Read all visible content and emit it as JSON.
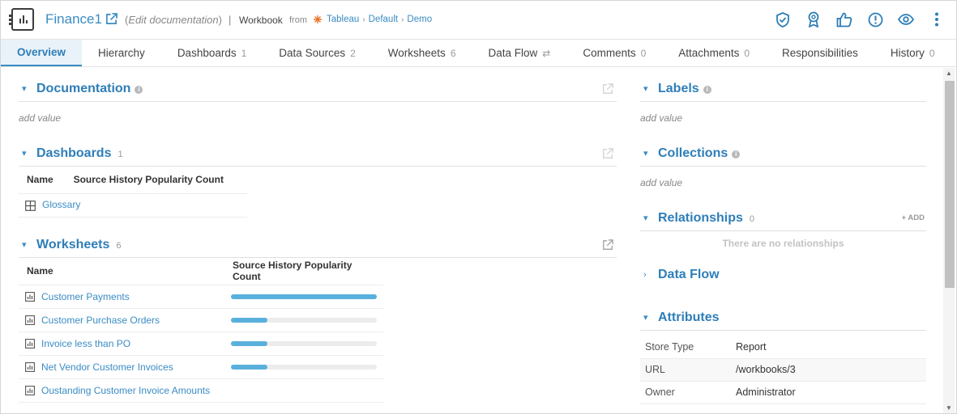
{
  "header": {
    "title": "Finance1",
    "edit_doc_open": "(",
    "edit_doc": "Edit documentation",
    "edit_doc_close": ")",
    "separator": "|",
    "type": "Workbook",
    "from": "from",
    "breadcrumb": [
      "Tableau",
      "Default",
      "Demo"
    ],
    "icons": [
      "shield-check-icon",
      "badge-icon",
      "thumbs-up-icon",
      "alert-icon",
      "eye-icon",
      "more-vertical-icon"
    ]
  },
  "tabs": [
    {
      "label": "Overview",
      "count": ""
    },
    {
      "label": "Hierarchy",
      "count": ""
    },
    {
      "label": "Dashboards",
      "count": "1"
    },
    {
      "label": "Data Sources",
      "count": "2"
    },
    {
      "label": "Worksheets",
      "count": "6"
    },
    {
      "label": "Data Flow",
      "count": "⇄"
    },
    {
      "label": "Comments",
      "count": "0"
    },
    {
      "label": "Attachments",
      "count": "0"
    },
    {
      "label": "Responsibilities",
      "count": ""
    },
    {
      "label": "History",
      "count": "0"
    }
  ],
  "documentation": {
    "title": "Documentation",
    "placeholder": "add value"
  },
  "dashboards": {
    "title": "Dashboards",
    "count": "1",
    "columns": [
      "Name",
      "Source History Popularity Count"
    ],
    "rows": [
      {
        "name": "Glossary"
      }
    ]
  },
  "worksheets": {
    "title": "Worksheets",
    "count": "6",
    "columns": [
      "Name",
      "Source History Popularity Count"
    ],
    "rows": [
      {
        "name": "Customer Payments",
        "popularity": 1.0
      },
      {
        "name": "Customer Purchase Orders",
        "popularity": 0.25
      },
      {
        "name": "Invoice less than PO",
        "popularity": 0.25
      },
      {
        "name": "Net Vendor Customer Invoices",
        "popularity": 0.25
      },
      {
        "name": "Oustanding Customer Invoice Amounts",
        "popularity": 0
      }
    ]
  },
  "labels": {
    "title": "Labels",
    "placeholder": "add value"
  },
  "collections": {
    "title": "Collections",
    "placeholder": "add value"
  },
  "relationships": {
    "title": "Relationships",
    "count": "0",
    "add": "+ ADD",
    "empty": "There are no relationships"
  },
  "data_flow": {
    "title": "Data Flow"
  },
  "attributes": {
    "title": "Attributes",
    "rows": [
      {
        "key": "Store Type",
        "value": "Report"
      },
      {
        "key": "URL",
        "value": "/workbooks/3"
      },
      {
        "key": "Owner",
        "value": "Administrator"
      }
    ]
  },
  "colors": {
    "accent": "#3a8cc4",
    "bar": "#5ab0dc"
  }
}
